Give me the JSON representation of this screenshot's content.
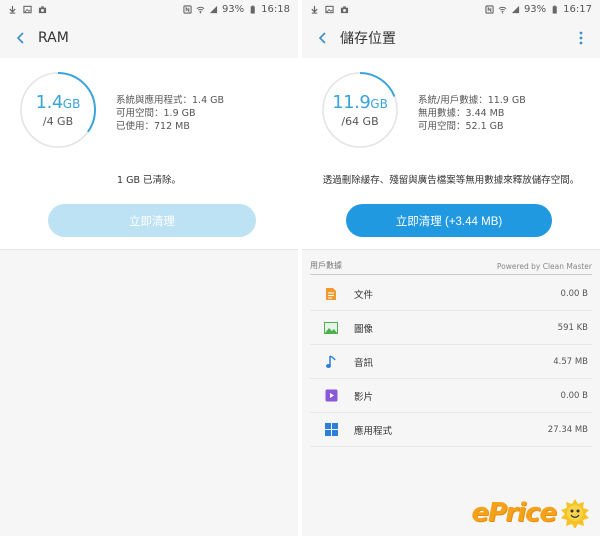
{
  "left": {
    "status": {
      "battery": "93%",
      "time": "16:18"
    },
    "appbar": {
      "title": "RAM"
    },
    "ring": {
      "used_value": "1.4",
      "used_unit": "GB",
      "total": "/4 GB",
      "fill_fraction": 0.35
    },
    "stats": [
      "系統與應用程式：1.4 GB",
      "可用空間：1.9 GB",
      "已使用：712 MB"
    ],
    "message": "1 GB 已清除。",
    "button": {
      "label": "立即清理"
    }
  },
  "right": {
    "status": {
      "battery": "93%",
      "time": "16:17"
    },
    "appbar": {
      "title": "儲存位置"
    },
    "ring": {
      "used_value": "11.9",
      "used_unit": "GB",
      "total": "/64 GB",
      "fill_fraction": 0.19
    },
    "stats": [
      "系統/用戶數據：11.9 GB",
      "無用數據：3.44 MB",
      "可用空間：52.1 GB"
    ],
    "message": "透過刪除緩存、殘留與廣告檔案等無用數據來釋放儲存空間。",
    "button": {
      "label": "立即清理 (+3.44 MB)"
    },
    "section": {
      "title": "用戶數據",
      "powered_by": "Powered by Clean Master"
    },
    "items": [
      {
        "label": "文件",
        "size": "0.00 B",
        "icon": "document-icon",
        "color": "#f29a2e"
      },
      {
        "label": "圖像",
        "size": "591 KB",
        "icon": "image-icon",
        "color": "#4caf50"
      },
      {
        "label": "音訊",
        "size": "4.57 MB",
        "icon": "music-note-icon",
        "color": "#2b7fd8"
      },
      {
        "label": "影片",
        "size": "0.00 B",
        "icon": "video-icon",
        "color": "#8a5ad6"
      },
      {
        "label": "應用程式",
        "size": "27.34 MB",
        "icon": "apps-grid-icon",
        "color": "#2b7fd8"
      }
    ]
  },
  "watermark": {
    "text": "ePrice"
  },
  "colors": {
    "accent": "#2199e0",
    "accent_light": "#bde2f4",
    "ring": "#3aa4dc",
    "background": "#f6f6f6"
  }
}
